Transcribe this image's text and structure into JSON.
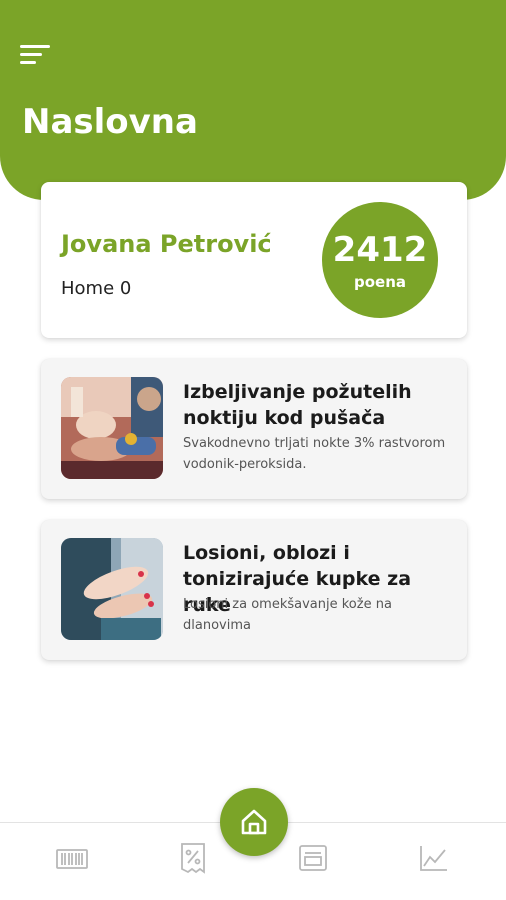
{
  "header": {
    "title": "Naslovna",
    "menu_icon": "menu-icon"
  },
  "profile": {
    "name": "Jovana Petrović",
    "subtitle": "Home 0",
    "points_value": "2412",
    "points_label": "poena"
  },
  "articles": [
    {
      "title": "Izbeljivanje požutelih noktiju kod pušača",
      "description": "Svakodnevno trljati nokte 3% rastvorom vodonik-peroksida.",
      "image": "manicure-photo"
    },
    {
      "title": "Losioni, oblozi i tonizirajuće kupke za ruke",
      "description": "Losioni za omekšavanje kože na dlanovima",
      "image": "hand-lotion-photo"
    }
  ],
  "nav": {
    "items": [
      "barcode-icon",
      "discount-icon",
      "receipt-icon",
      "chart-icon"
    ],
    "center": "home-icon"
  },
  "colors": {
    "brand": "#7ba428",
    "card_bg": "#f5f5f5",
    "icon_gray": "#b8b8b8"
  }
}
